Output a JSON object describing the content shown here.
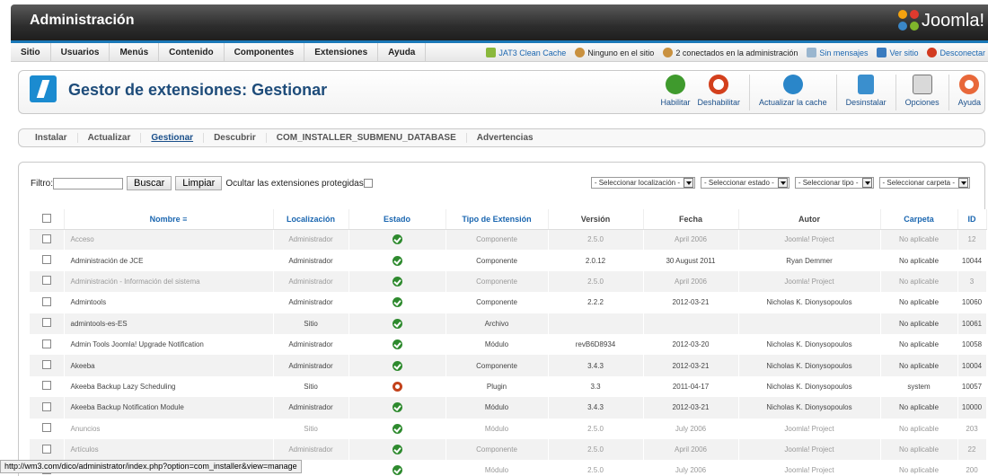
{
  "header": {
    "title": "Administración",
    "brand": "Joomla!"
  },
  "menu": [
    "Sitio",
    "Usuarios",
    "Menús",
    "Contenido",
    "Componentes",
    "Extensiones",
    "Ayuda"
  ],
  "status": {
    "template": "JAT3 Clean Cache",
    "site_users": "Ninguno en el sitio",
    "admin_users": "2 conectados en la administración",
    "messages": "Sin mensajes",
    "view_site": "Ver sitio",
    "logout": "Desconectar"
  },
  "toolbar": {
    "title": "Gestor de extensiones: Gestionar",
    "buttons": {
      "enable": "Habilitar",
      "disable": "Deshabilitar",
      "refresh": "Actualizar la cache",
      "uninstall": "Desinstalar",
      "options": "Opciones",
      "help": "Ayuda"
    }
  },
  "subtabs": [
    "Instalar",
    "Actualizar",
    "Gestionar",
    "Descubrir",
    "COM_INSTALLER_SUBMENU_DATABASE",
    "Advertencias"
  ],
  "filters": {
    "label": "Filtro:",
    "search_button": "Buscar",
    "clear_button": "Limpiar",
    "hide_protected": "Ocultar las extensiones protegidas",
    "selects": [
      "- Seleccionar localización -",
      "- Seleccionar estado -",
      "- Seleccionar tipo -",
      "- Seleccionar carpeta -"
    ]
  },
  "table": {
    "columns": [
      "Nombre",
      "Localización",
      "Estado",
      "Tipo de Extensión",
      "Versión",
      "Fecha",
      "Autor",
      "Carpeta",
      "ID"
    ],
    "rows": [
      {
        "name": "Acceso",
        "location": "Administrador",
        "status": "enabled",
        "type": "Componente",
        "version": "2.5.0",
        "date": "April 2006",
        "author": "Joomla! Project",
        "folder": "No aplicable",
        "id": "12",
        "protected": true
      },
      {
        "name": "Administración de JCE",
        "location": "Administrador",
        "status": "enabled",
        "type": "Componente",
        "version": "2.0.12",
        "date": "30 August 2011",
        "author": "Ryan Demmer",
        "folder": "No aplicable",
        "id": "10044",
        "protected": false
      },
      {
        "name": "Administración - Información del sistema",
        "location": "Administrador",
        "status": "enabled",
        "type": "Componente",
        "version": "2.5.0",
        "date": "April 2006",
        "author": "Joomla! Project",
        "folder": "No aplicable",
        "id": "3",
        "protected": true
      },
      {
        "name": "Admintools",
        "location": "Administrador",
        "status": "enabled",
        "type": "Componente",
        "version": "2.2.2",
        "date": "2012-03-21",
        "author": "Nicholas K. Dionysopoulos",
        "folder": "No aplicable",
        "id": "10060",
        "protected": false
      },
      {
        "name": "admintools-es-ES",
        "location": "Sitio",
        "status": "enabled",
        "type": "Archivo",
        "version": "",
        "date": "",
        "author": "",
        "folder": "No aplicable",
        "id": "10061",
        "protected": false
      },
      {
        "name": "Admin Tools Joomla! Upgrade Notification",
        "location": "Administrador",
        "status": "enabled",
        "type": "Módulo",
        "version": "revB6D8934",
        "date": "2012-03-20",
        "author": "Nicholas K. Dionysopoulos",
        "folder": "No aplicable",
        "id": "10058",
        "protected": false
      },
      {
        "name": "Akeeba",
        "location": "Administrador",
        "status": "enabled",
        "type": "Componente",
        "version": "3.4.3",
        "date": "2012-03-21",
        "author": "Nicholas K. Dionysopoulos",
        "folder": "No aplicable",
        "id": "10004",
        "protected": false
      },
      {
        "name": "Akeeba Backup Lazy Scheduling",
        "location": "Sitio",
        "status": "disabled",
        "type": "Plugin",
        "version": "3.3",
        "date": "2011-04-17",
        "author": "Nicholas K. Dionysopoulos",
        "folder": "system",
        "id": "10057",
        "protected": false
      },
      {
        "name": "Akeeba Backup Notification Module",
        "location": "Administrador",
        "status": "enabled",
        "type": "Módulo",
        "version": "3.4.3",
        "date": "2012-03-21",
        "author": "Nicholas K. Dionysopoulos",
        "folder": "No aplicable",
        "id": "10000",
        "protected": false
      },
      {
        "name": "Anuncios",
        "location": "Sitio",
        "status": "enabled",
        "type": "Módulo",
        "version": "2.5.0",
        "date": "July 2006",
        "author": "Joomla! Project",
        "folder": "No aplicable",
        "id": "203",
        "protected": true
      },
      {
        "name": "Artículos",
        "location": "Administrador",
        "status": "enabled",
        "type": "Componente",
        "version": "2.5.0",
        "date": "April 2006",
        "author": "Joomla! Project",
        "folder": "No aplicable",
        "id": "22",
        "protected": true
      },
      {
        "name": "",
        "location": "",
        "status": "enabled",
        "type": "Módulo",
        "version": "2.5.0",
        "date": "July 2006",
        "author": "Joomla! Project",
        "folder": "No aplicable",
        "id": "200",
        "protected": true
      }
    ]
  },
  "statusbar": {
    "url": "http://wm3.com/dico/administrator/index.php?option=com_installer&view=manage"
  },
  "colors": {
    "enabled": "#2e8a2e",
    "disabled": "#c3421b",
    "accent": "#1a66b0"
  }
}
